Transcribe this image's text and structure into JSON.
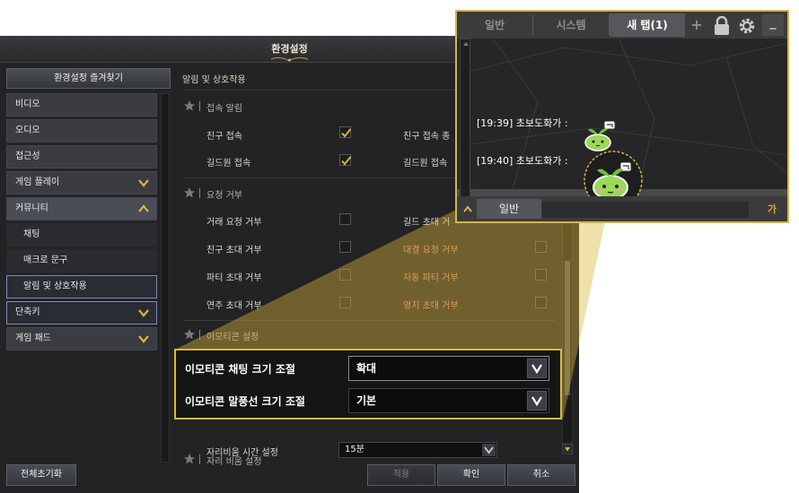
{
  "window": {
    "title": "환경설정",
    "favorites_button": "환경설정 즐겨찾기"
  },
  "sidebar": {
    "items": [
      {
        "label": "비디오"
      },
      {
        "label": "오디오"
      },
      {
        "label": "접근성"
      },
      {
        "label": "게임 플레이",
        "chevron": "down"
      },
      {
        "label": "커뮤니티",
        "chevron": "up",
        "expanded": true
      },
      {
        "label": "채팅",
        "sub": true
      },
      {
        "label": "매크로 문구",
        "sub": true
      },
      {
        "label": "알림 및 상호작용",
        "sub": true,
        "selected": true
      },
      {
        "label": "단축키",
        "chevron": "down"
      },
      {
        "label": "게임 패드",
        "chevron": "down"
      }
    ]
  },
  "content": {
    "section_title": "알림 및 상호작용",
    "groups": [
      {
        "title": "접속 알림",
        "options": [
          {
            "label": "친구 접속",
            "checked": true
          },
          {
            "label": "친구 접속 종",
            "checked": false
          },
          {
            "label": "길드원 접속",
            "checked": true
          },
          {
            "label": "길드원 접속 ",
            "checked": false
          }
        ]
      },
      {
        "title": "요청 거부",
        "options": [
          {
            "label": "거래 요청 거부",
            "checked": false
          },
          {
            "label": "길드 초대 거",
            "checked": false
          },
          {
            "label": "친구 초대 거부",
            "checked": false
          },
          {
            "label": "대결 요청 거부",
            "checked": false
          },
          {
            "label": "파티 초대 거부",
            "checked": false
          },
          {
            "label": "자동 파티 거부",
            "checked": false
          },
          {
            "label": "연주 초대 거부",
            "checked": false
          },
          {
            "label": "영지 초대 거부",
            "checked": false
          }
        ]
      },
      {
        "title": "이모티콘 설정"
      },
      {
        "title": "자리 비움 설정"
      }
    ],
    "away_setting": {
      "label": "자리비움 시간 설정",
      "value": "15분"
    }
  },
  "buttons": {
    "reset_all": "전체초기화",
    "apply": "적용",
    "ok": "확인",
    "cancel": "취소"
  },
  "emoticon_zoom": {
    "chat_size_label": "이모티콘 채팅 크기 조절",
    "chat_size_value": "확대",
    "bubble_size_label": "이모티콘 말풍선 크기 조절",
    "bubble_size_value": "기본"
  },
  "chat_zoom": {
    "tabs": [
      "일반",
      "시스템",
      "새 탭(1)"
    ],
    "active_tab": "새 탭(1)",
    "add_tab": "+",
    "minimize": "_",
    "messages": [
      {
        "time": "[19:39]",
        "sender": "초보도화가 :"
      },
      {
        "time": "[19:40]",
        "sender": "초보도화가 :"
      }
    ],
    "bottom_tab": "일반",
    "input_indicator": "가"
  },
  "colors": {
    "highlight": "#d9b63a",
    "window_bg": "#232326",
    "emoticon_green": "#8fd14f"
  }
}
